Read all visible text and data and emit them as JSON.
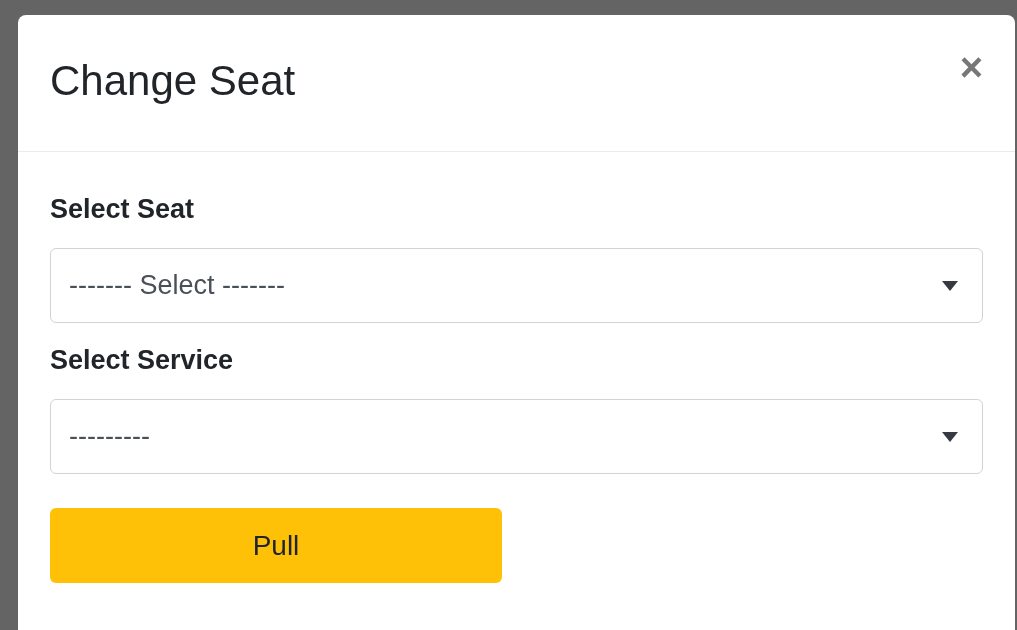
{
  "modal": {
    "title": "Change Seat",
    "close": "×"
  },
  "fields": [
    {
      "label": "Select Seat",
      "value": "------- Select -------"
    },
    {
      "label": "Select Service",
      "value": "---------"
    }
  ],
  "button": {
    "label": "Pull"
  }
}
